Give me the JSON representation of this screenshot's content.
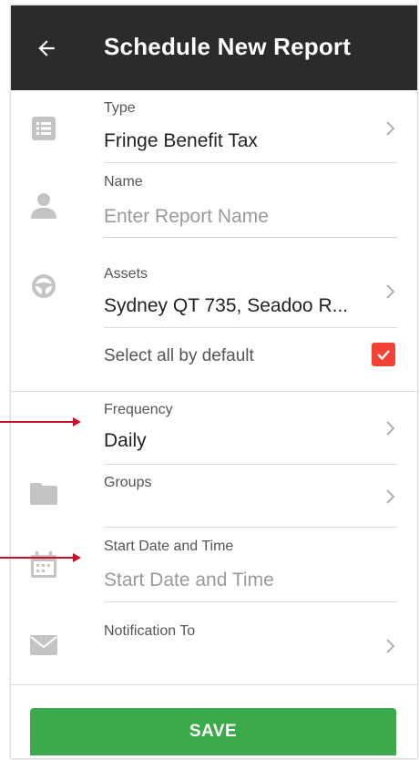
{
  "header": {
    "title": "Schedule New Report",
    "back_icon": "arrow-left-icon"
  },
  "fields": {
    "type": {
      "label": "Type",
      "value": "Fringe Benefit Tax"
    },
    "name": {
      "label": "Name",
      "placeholder": "Enter Report Name"
    },
    "assets": {
      "label": "Assets",
      "value": "Sydney QT 735, Seadoo R..."
    },
    "select_all": {
      "label": "Select all by default",
      "checked": true
    },
    "frequency": {
      "label": "Frequency",
      "value": "Daily"
    },
    "groups": {
      "label": "Groups",
      "value": ""
    },
    "start_date": {
      "label": "Start Date and Time",
      "placeholder": "Start Date and Time"
    },
    "notification": {
      "label": "Notification To",
      "value": ""
    }
  },
  "actions": {
    "save_label": "SAVE"
  },
  "colors": {
    "appbar": "#2b2b2b",
    "save": "#3aaa4a",
    "checkbox": "#f44336",
    "annotation_arrow": "#c8102e",
    "icon": "#c4c4c4"
  }
}
